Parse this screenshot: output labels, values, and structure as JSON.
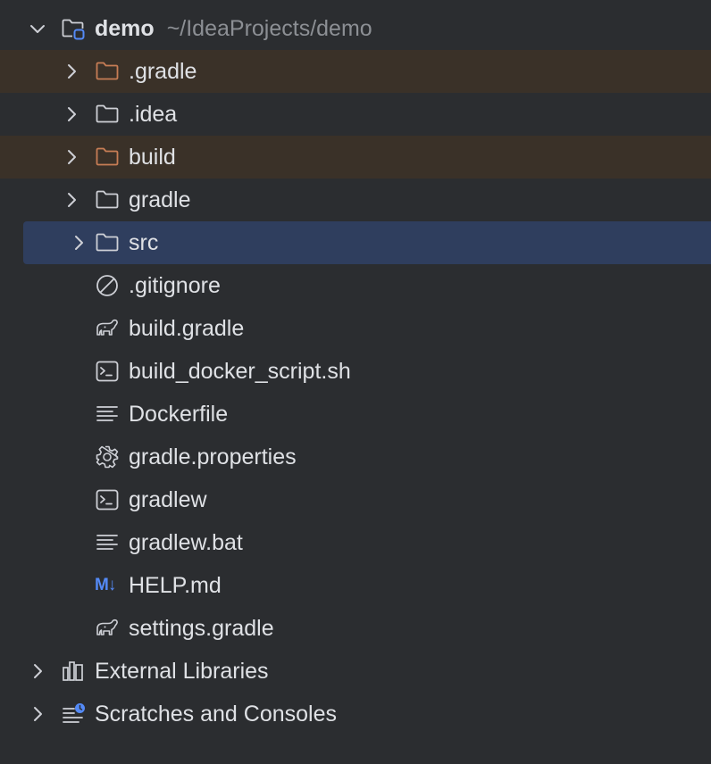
{
  "project": {
    "name": "demo",
    "path": "~/IdeaProjects/demo",
    "expanded": true,
    "icon": "project-folder-icon"
  },
  "children": [
    {
      "name": ".gradle",
      "type": "folder",
      "state": "excluded",
      "icon": "folder-icon"
    },
    {
      "name": ".idea",
      "type": "folder",
      "state": "normal",
      "icon": "folder-icon"
    },
    {
      "name": "build",
      "type": "folder",
      "state": "excluded",
      "icon": "folder-icon"
    },
    {
      "name": "gradle",
      "type": "folder",
      "state": "normal",
      "icon": "folder-icon"
    },
    {
      "name": "src",
      "type": "folder",
      "state": "selected",
      "icon": "folder-icon"
    },
    {
      "name": ".gitignore",
      "type": "file",
      "icon": "gitignore-icon"
    },
    {
      "name": "build.gradle",
      "type": "file",
      "icon": "gradle-elephant-icon"
    },
    {
      "name": "build_docker_script.sh",
      "type": "file",
      "icon": "shell-script-icon"
    },
    {
      "name": "Dockerfile",
      "type": "file",
      "icon": "text-file-icon"
    },
    {
      "name": "gradle.properties",
      "type": "file",
      "icon": "gear-icon"
    },
    {
      "name": "gradlew",
      "type": "file",
      "icon": "shell-script-icon"
    },
    {
      "name": "gradlew.bat",
      "type": "file",
      "icon": "text-file-icon"
    },
    {
      "name": "HELP.md",
      "type": "file",
      "icon": "markdown-icon",
      "icon_text": "M↓"
    },
    {
      "name": "settings.gradle",
      "type": "file",
      "icon": "gradle-elephant-icon"
    }
  ],
  "root_items": [
    {
      "name": "External Libraries",
      "icon": "library-icon"
    },
    {
      "name": "Scratches and Consoles",
      "icon": "scratches-icon"
    }
  ],
  "colors": {
    "background": "#2b2d30",
    "excluded_row": "#3a3128",
    "selected_row": "#2f3e5e",
    "excluded_folder": "#c77d55",
    "text": "#dfe1e5",
    "path_text": "#8c8f94",
    "markdown_blue": "#548af7",
    "icon_stroke": "#ced0d6"
  }
}
